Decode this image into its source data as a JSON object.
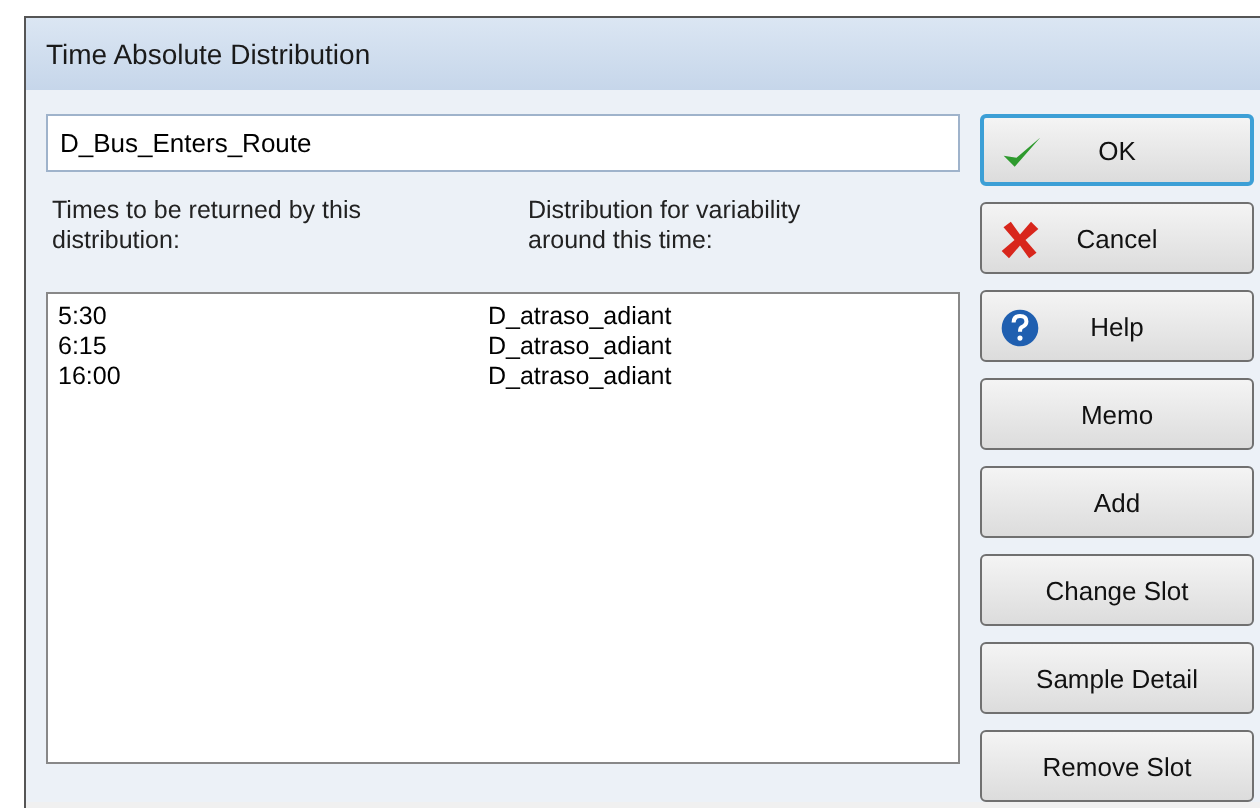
{
  "window": {
    "title": "Time Absolute Distribution"
  },
  "name_field": {
    "value": "D_Bus_Enters_Route"
  },
  "column_labels": [
    "Times to be returned by this distribution:",
    "Distribution for variability around this time:"
  ],
  "rows": [
    {
      "time": "5:30",
      "distribution": "D_atraso_adiant"
    },
    {
      "time": "6:15",
      "distribution": "D_atraso_adiant"
    },
    {
      "time": "16:00",
      "distribution": "D_atraso_adiant"
    }
  ],
  "buttons": [
    {
      "label": "OK",
      "kind": "ok"
    },
    {
      "label": "Cancel",
      "kind": "cancel"
    },
    {
      "label": "Help",
      "kind": "help"
    },
    {
      "label": "Memo",
      "kind": "plain"
    },
    {
      "label": "Add",
      "kind": "plain"
    },
    {
      "label": "Change Slot",
      "kind": "plain"
    },
    {
      "label": "Sample Detail",
      "kind": "plain"
    },
    {
      "label": "Remove Slot",
      "kind": "plain"
    }
  ]
}
